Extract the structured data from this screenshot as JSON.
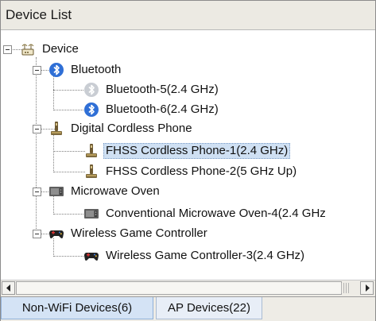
{
  "panel": {
    "title": "Device List"
  },
  "tree": {
    "root": "Device",
    "groups": [
      {
        "label": "Bluetooth",
        "icon": "bluetooth-icon",
        "children": [
          {
            "label": "Bluetooth-5(2.4 GHz)",
            "icon": "bluetooth-inactive-icon"
          },
          {
            "label": "Bluetooth-6(2.4 GHz)",
            "icon": "bluetooth-icon"
          }
        ]
      },
      {
        "label": "Digital Cordless Phone",
        "icon": "cordless-phone-icon",
        "children": [
          {
            "label": "FHSS Cordless Phone-1(2.4 GHz)",
            "icon": "cordless-phone-icon",
            "selected": true
          },
          {
            "label": "FHSS Cordless Phone-2(5 GHz Up)",
            "icon": "cordless-phone-icon"
          }
        ]
      },
      {
        "label": "Microwave Oven",
        "icon": "microwave-icon",
        "children": [
          {
            "label": "Conventional Microwave Oven-4(2.4 GHz",
            "icon": "microwave-icon"
          }
        ]
      },
      {
        "label": "Wireless Game Controller",
        "icon": "gamepad-icon",
        "children": [
          {
            "label": "Wireless Game Controller-3(2.4 GHz)",
            "icon": "gamepad-icon"
          }
        ]
      }
    ]
  },
  "tabs": [
    {
      "label": "Non-WiFi Devices(6)",
      "active": true
    },
    {
      "label": "AP Devices(22)",
      "active": false
    }
  ],
  "colors": {
    "selection": "#cfe0f3",
    "bluetooth_blue": "#2f6fd6",
    "tab_active": "#d4e3f5"
  }
}
